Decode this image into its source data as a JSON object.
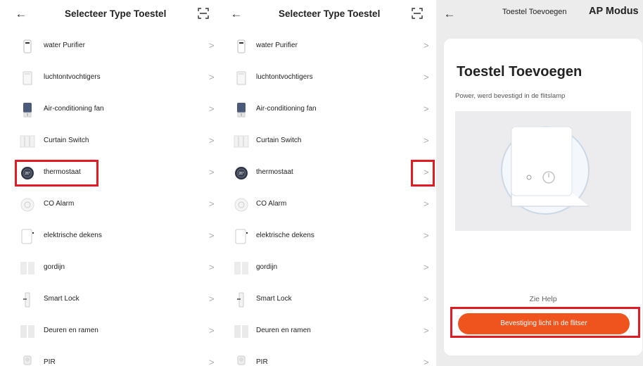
{
  "left_screen": {
    "title": "Selecteer Type Toestel",
    "chevron": ">",
    "devices": [
      {
        "label": "water Purifier",
        "icon": "water-purifier-icon"
      },
      {
        "label": "luchtontvochtigers",
        "icon": "dehumidifier-icon"
      },
      {
        "label": "Air-conditioning fan",
        "icon": "air-conditioning-fan-icon"
      },
      {
        "label": "Curtain Switch",
        "icon": "curtain-switch-icon"
      },
      {
        "label": "thermostaat",
        "icon": "thermostat-icon"
      },
      {
        "label": "CO Alarm",
        "icon": "co-alarm-icon"
      },
      {
        "label": "elektrische dekens",
        "icon": "electric-blanket-icon"
      },
      {
        "label": "gordijn",
        "icon": "curtain-icon"
      },
      {
        "label": "Smart Lock",
        "icon": "smart-lock-icon"
      },
      {
        "label": "Deuren en ramen",
        "icon": "door-window-sensor-icon"
      },
      {
        "label": "PIR",
        "icon": "pir-sensor-icon"
      }
    ]
  },
  "middle_screen": {
    "title": "Selecteer Type Toestel",
    "chevron": ">",
    "devices": [
      {
        "label": "water Purifier",
        "icon": "water-purifier-icon"
      },
      {
        "label": "luchtontvochtigers",
        "icon": "dehumidifier-icon"
      },
      {
        "label": "Air-conditioning fan",
        "icon": "air-conditioning-fan-icon"
      },
      {
        "label": "Curtain Switch",
        "icon": "curtain-switch-icon"
      },
      {
        "label": "thermostaat",
        "icon": "thermostat-icon"
      },
      {
        "label": "CO Alarm",
        "icon": "co-alarm-icon"
      },
      {
        "label": "elektrische dekens",
        "icon": "electric-blanket-icon"
      },
      {
        "label": "gordijn",
        "icon": "curtain-icon"
      },
      {
        "label": "Smart Lock",
        "icon": "smart-lock-icon"
      },
      {
        "label": "Deuren en ramen",
        "icon": "door-window-sensor-icon"
      },
      {
        "label": "PIR",
        "icon": "pir-sensor-icon"
      }
    ]
  },
  "right_screen": {
    "title": "Toestel Toevoegen",
    "mode": "AP Modus",
    "card_title": "Toestel Toevoegen",
    "card_subtitle": "Power, werd bevestigd in de flitslamp",
    "help_link": "Zie Help",
    "confirm_button": "Bevestiging licht in de flitser"
  },
  "colors": {
    "accent": "#f0541e",
    "highlight": "#e01b24",
    "background": "#ececec"
  }
}
